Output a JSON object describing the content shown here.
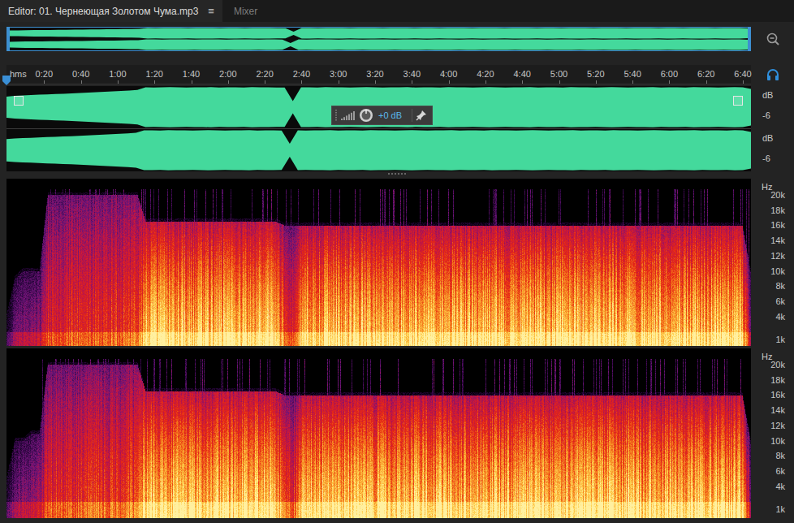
{
  "tabs": [
    {
      "label": "Editor: 01. Чернеющая Золотом Чума.mp3",
      "selected": true,
      "menu": "≡"
    },
    {
      "label": "Mixer",
      "selected": false
    }
  ],
  "ruler": {
    "unit": "hms",
    "ticks": [
      "0:20",
      "0:40",
      "1:00",
      "1:20",
      "1:40",
      "2:00",
      "2:20",
      "2:40",
      "3:00",
      "3:20",
      "3:40",
      "4:00",
      "4:20",
      "4:40",
      "5:00",
      "5:20",
      "5:40",
      "6:00",
      "6:20",
      "6:40"
    ]
  },
  "playhead": {
    "level": 0
  },
  "hud": {
    "reading": "+0 dB"
  },
  "waveform": {
    "channels": [
      {
        "unit": "dB",
        "tick": "-6",
        "envelope": [
          0.52,
          0.56,
          0.58,
          0.6,
          0.62,
          0.63,
          0.65,
          0.66,
          0.68,
          0.7,
          0.72,
          0.74,
          0.76,
          0.78,
          0.8,
          0.82,
          0.85,
          0.98,
          0.97,
          0.98,
          0.99,
          0.98,
          0.97,
          0.98,
          0.98,
          0.99,
          0.97,
          0.98,
          0.98,
          0.97,
          0.99,
          0.98,
          0.98,
          0.97,
          0.97,
          0.3,
          0.98,
          0.98,
          0.97,
          0.99,
          0.98,
          0.98,
          0.97,
          0.98,
          0.99,
          0.98,
          0.97,
          0.98,
          0.98,
          0.99,
          0.97,
          0.98,
          0.98,
          0.97,
          0.99,
          0.98,
          0.98,
          0.97,
          0.98,
          0.99,
          0.98,
          0.97,
          0.98,
          0.98,
          0.99,
          0.97,
          0.98,
          0.98,
          0.97,
          0.99,
          0.98,
          0.98,
          0.97,
          0.98,
          0.99,
          0.98,
          0.97,
          0.98,
          0.98,
          0.99,
          0.97,
          0.98,
          0.98,
          0.97,
          0.99,
          0.98,
          0.98,
          0.97,
          0.98,
          0.99,
          0.98,
          0.9
        ]
      },
      {
        "unit": "dB",
        "tick": "-6",
        "envelope": [
          0.55,
          0.58,
          0.6,
          0.61,
          0.63,
          0.65,
          0.66,
          0.68,
          0.69,
          0.71,
          0.73,
          0.75,
          0.77,
          0.79,
          0.81,
          0.83,
          0.86,
          0.98,
          0.98,
          0.97,
          0.99,
          0.98,
          0.98,
          0.97,
          0.98,
          0.99,
          0.98,
          0.97,
          0.98,
          0.98,
          0.99,
          0.97,
          0.98,
          0.98,
          0.97,
          0.32,
          0.98,
          0.97,
          0.98,
          0.98,
          0.99,
          0.97,
          0.98,
          0.98,
          0.97,
          0.99,
          0.98,
          0.98,
          0.97,
          0.98,
          0.99,
          0.98,
          0.97,
          0.98,
          0.98,
          0.99,
          0.97,
          0.98,
          0.98,
          0.97,
          0.99,
          0.98,
          0.98,
          0.97,
          0.98,
          0.99,
          0.98,
          0.97,
          0.98,
          0.98,
          0.99,
          0.97,
          0.98,
          0.98,
          0.97,
          0.99,
          0.98,
          0.98,
          0.97,
          0.98,
          0.99,
          0.98,
          0.97,
          0.98,
          0.98,
          0.99,
          0.97,
          0.98,
          0.98,
          0.97,
          0.99,
          0.98,
          0.9
        ]
      }
    ]
  },
  "spectrogram": {
    "channels": [
      {
        "unit": "Hz",
        "ticks": [
          "20k",
          "18k",
          "16k",
          "14k",
          "12k",
          "10k",
          "8k",
          "6k",
          "4k",
          "1k"
        ],
        "intensity": [
          0.1,
          0.3,
          0.35,
          0.35,
          0.38,
          0.55,
          0.58,
          0.55,
          0.6,
          0.57,
          0.6,
          0.62,
          0.6,
          0.63,
          0.62,
          0.65,
          0.66,
          0.9,
          0.9,
          0.91,
          0.9,
          0.9,
          0.92,
          0.9,
          0.91,
          0.9,
          0.9,
          0.92,
          0.9,
          0.91,
          0.9,
          0.9,
          0.92,
          0.9,
          0.7,
          0.55,
          0.88,
          0.9,
          0.91,
          0.9,
          0.92,
          0.9,
          0.9,
          0.91,
          0.9,
          0.92,
          0.9,
          0.9,
          0.91,
          0.9,
          0.92,
          0.9,
          0.9,
          0.91,
          0.9,
          0.92,
          0.9,
          0.9,
          0.91,
          0.9,
          0.92,
          0.9,
          0.9,
          0.91,
          0.9,
          0.92,
          0.9,
          0.9,
          0.91,
          0.9,
          0.92,
          0.9,
          0.9,
          0.91,
          0.9,
          0.92,
          0.9,
          0.9,
          0.91,
          0.9,
          0.92,
          0.9,
          0.9,
          0.91,
          0.9,
          0.92,
          0.9,
          0.9,
          0.91,
          0.9,
          0.92,
          0.35
        ],
        "cutoff_khz": [
          4,
          9,
          10,
          10,
          10,
          20,
          20,
          20,
          20,
          20,
          20,
          20,
          20,
          20,
          20,
          20,
          20,
          16.5,
          16.5,
          16.5,
          16.5,
          16.5,
          16.5,
          16.5,
          16.5,
          16.5,
          16.5,
          16.5,
          16.5,
          16.5,
          16.5,
          16.5,
          16.5,
          16.5,
          16,
          16,
          16,
          16,
          16,
          16,
          16,
          16,
          16,
          16,
          16,
          16,
          16,
          16,
          16,
          16,
          16,
          16,
          16,
          16,
          16,
          16,
          16,
          16,
          16,
          16,
          16,
          16,
          16,
          16,
          16,
          16,
          16,
          16,
          16,
          16,
          16,
          16,
          16,
          16,
          16,
          16,
          16,
          16,
          16,
          16,
          16,
          16,
          16,
          16,
          16,
          16,
          16,
          16,
          16,
          16,
          16,
          10
        ]
      },
      {
        "unit": "Hz",
        "ticks": [
          "20k",
          "18k",
          "16k",
          "14k",
          "12k",
          "10k",
          "8k",
          "6k",
          "4k",
          "1k"
        ],
        "intensity": [
          0.12,
          0.32,
          0.36,
          0.37,
          0.4,
          0.56,
          0.6,
          0.57,
          0.61,
          0.58,
          0.61,
          0.63,
          0.61,
          0.64,
          0.63,
          0.66,
          0.67,
          0.9,
          0.91,
          0.9,
          0.9,
          0.92,
          0.9,
          0.91,
          0.9,
          0.9,
          0.92,
          0.9,
          0.91,
          0.9,
          0.9,
          0.92,
          0.9,
          0.9,
          0.7,
          0.55,
          0.88,
          0.91,
          0.9,
          0.92,
          0.9,
          0.9,
          0.91,
          0.9,
          0.92,
          0.9,
          0.9,
          0.91,
          0.9,
          0.92,
          0.9,
          0.9,
          0.91,
          0.9,
          0.92,
          0.9,
          0.9,
          0.91,
          0.9,
          0.92,
          0.9,
          0.9,
          0.91,
          0.9,
          0.92,
          0.9,
          0.9,
          0.91,
          0.9,
          0.92,
          0.9,
          0.9,
          0.91,
          0.9,
          0.92,
          0.9,
          0.9,
          0.91,
          0.9,
          0.92,
          0.9,
          0.9,
          0.91,
          0.9,
          0.92,
          0.9,
          0.9,
          0.91,
          0.9,
          0.92,
          0.9,
          0.35
        ],
        "cutoff_khz": [
          5,
          10,
          10,
          11,
          11,
          20,
          20,
          20,
          20,
          20,
          20,
          20,
          20,
          20,
          20,
          20,
          20,
          16.5,
          16.5,
          16.5,
          16.5,
          16.5,
          16.5,
          16.5,
          16.5,
          16.5,
          16.5,
          16.5,
          16.5,
          16.5,
          16.5,
          16.5,
          16.5,
          16.5,
          16,
          16,
          16,
          16,
          16,
          16,
          16,
          16,
          16,
          16,
          16,
          16,
          16,
          16,
          16,
          16,
          16,
          16,
          16,
          16,
          16,
          16,
          16,
          16,
          16,
          16,
          16,
          16,
          16,
          16,
          16,
          16,
          16,
          16,
          16,
          16,
          16,
          16,
          16,
          16,
          16,
          16,
          16,
          16,
          16,
          16,
          16,
          16,
          16,
          16,
          16,
          16,
          16,
          16,
          16,
          16,
          16,
          10
        ]
      }
    ]
  }
}
